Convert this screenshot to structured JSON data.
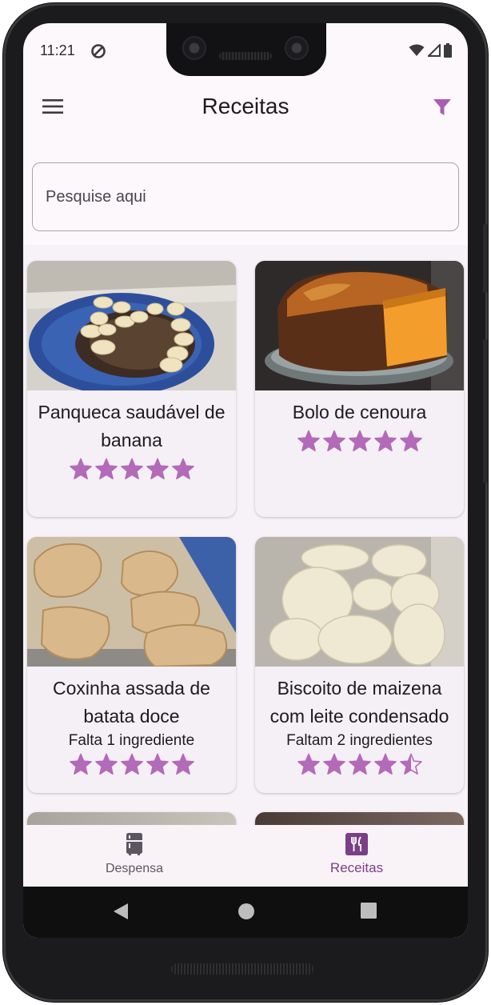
{
  "status_bar": {
    "time": "11:21"
  },
  "app_bar": {
    "title": "Receitas"
  },
  "search": {
    "placeholder": "Pesquise aqui"
  },
  "recipes": [
    {
      "name": "Panqueca saudável de banana",
      "missing": "",
      "rating": 5
    },
    {
      "name": "Bolo de cenoura",
      "missing": "",
      "rating": 5
    },
    {
      "name": "Coxinha assada de batata doce",
      "missing": "Falta 1 ingrediente",
      "rating": 5
    },
    {
      "name": "Biscoito de maizena com leite condensado",
      "missing": "Faltam 2 ingredientes",
      "rating": 4.5
    }
  ],
  "bottom_nav": {
    "items": [
      {
        "label": "Despensa",
        "icon": "fridge-icon",
        "active": false
      },
      {
        "label": "Receitas",
        "icon": "restaurant-icon",
        "active": true
      }
    ]
  },
  "colors": {
    "accent": "#b36ab8",
    "active_nav": "#7a3f86",
    "inactive_nav": "#5b5660"
  }
}
